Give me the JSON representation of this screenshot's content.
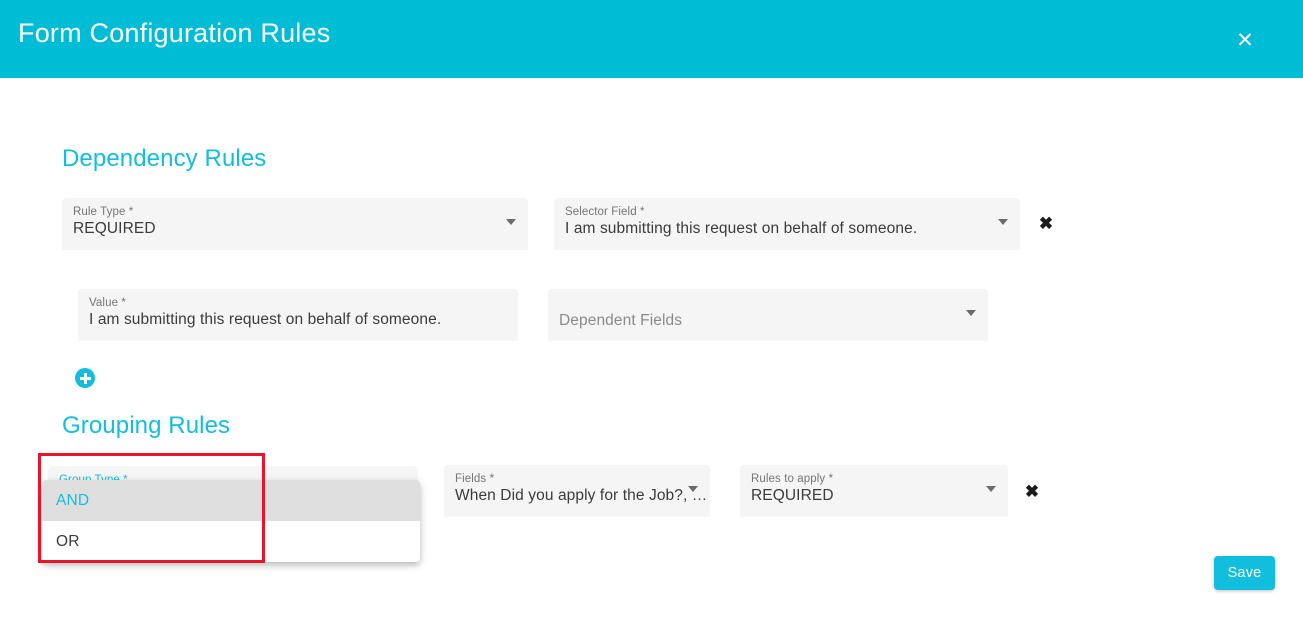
{
  "header": {
    "title": "Form Configuration Rules",
    "close_icon": "close-icon",
    "close_label": "✕",
    "background_color": "#00bcd4"
  },
  "accent_color": "#12bedd",
  "annotation": {
    "color": "#e8142a",
    "shape": "rectangle"
  },
  "sections": {
    "dependency": {
      "title": "Dependency Rules",
      "fields": {
        "rule_type": {
          "label": "Rule Type *",
          "value": "REQUIRED",
          "type": "select"
        },
        "selector_field": {
          "label": "Selector Field *",
          "value": "I am submitting this request on behalf of someone.",
          "type": "select"
        },
        "value": {
          "label": "Value *",
          "value": "I am submitting this request on behalf of someone.",
          "type": "text"
        },
        "dependent_fields": {
          "placeholder": "Dependent Fields",
          "value": "",
          "type": "select"
        }
      },
      "remove_label": "✖",
      "add_label": "add-rule"
    },
    "grouping": {
      "title": "Grouping Rules",
      "fields": {
        "group_type": {
          "label": "Group Type *",
          "value": "AND",
          "type": "select"
        },
        "fields": {
          "label": "Fields *",
          "value": "When Did you apply for the Job?, …",
          "type": "select"
        },
        "rules_to_apply": {
          "label": "Rules to apply *",
          "value": "REQUIRED",
          "type": "select"
        }
      },
      "remove_label": "✖"
    }
  },
  "dropdown": {
    "open": true,
    "options": [
      {
        "label": "AND",
        "selected": true
      },
      {
        "label": "OR",
        "selected": false
      }
    ]
  },
  "footer": {
    "save_label": "Save"
  },
  "scrollbar": {
    "color": "#22c8e0"
  }
}
